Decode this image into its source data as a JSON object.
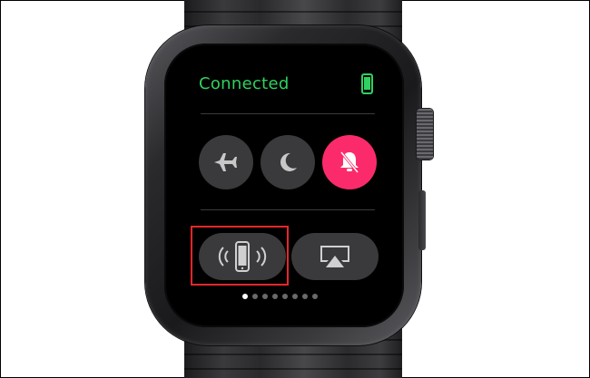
{
  "status": {
    "connection_label": "Connected",
    "connection_color": "#2fd160",
    "phone_icon": "phone-connected-icon"
  },
  "quick_toggles": [
    {
      "name": "airplane-mode",
      "icon": "airplane-icon",
      "active": false
    },
    {
      "name": "do-not-disturb",
      "icon": "moon-icon",
      "active": false
    },
    {
      "name": "silent-mode",
      "icon": "bell-slash-icon",
      "active": true,
      "color": "#fb2b6b"
    }
  ],
  "actions": [
    {
      "name": "ping-iphone",
      "icon": "ping-phone-icon",
      "highlighted": true
    },
    {
      "name": "airplay",
      "icon": "airplay-icon",
      "highlighted": false
    }
  ],
  "pagination": {
    "total_pages": 8,
    "current_page": 1
  },
  "highlight_color": "#e8262a"
}
